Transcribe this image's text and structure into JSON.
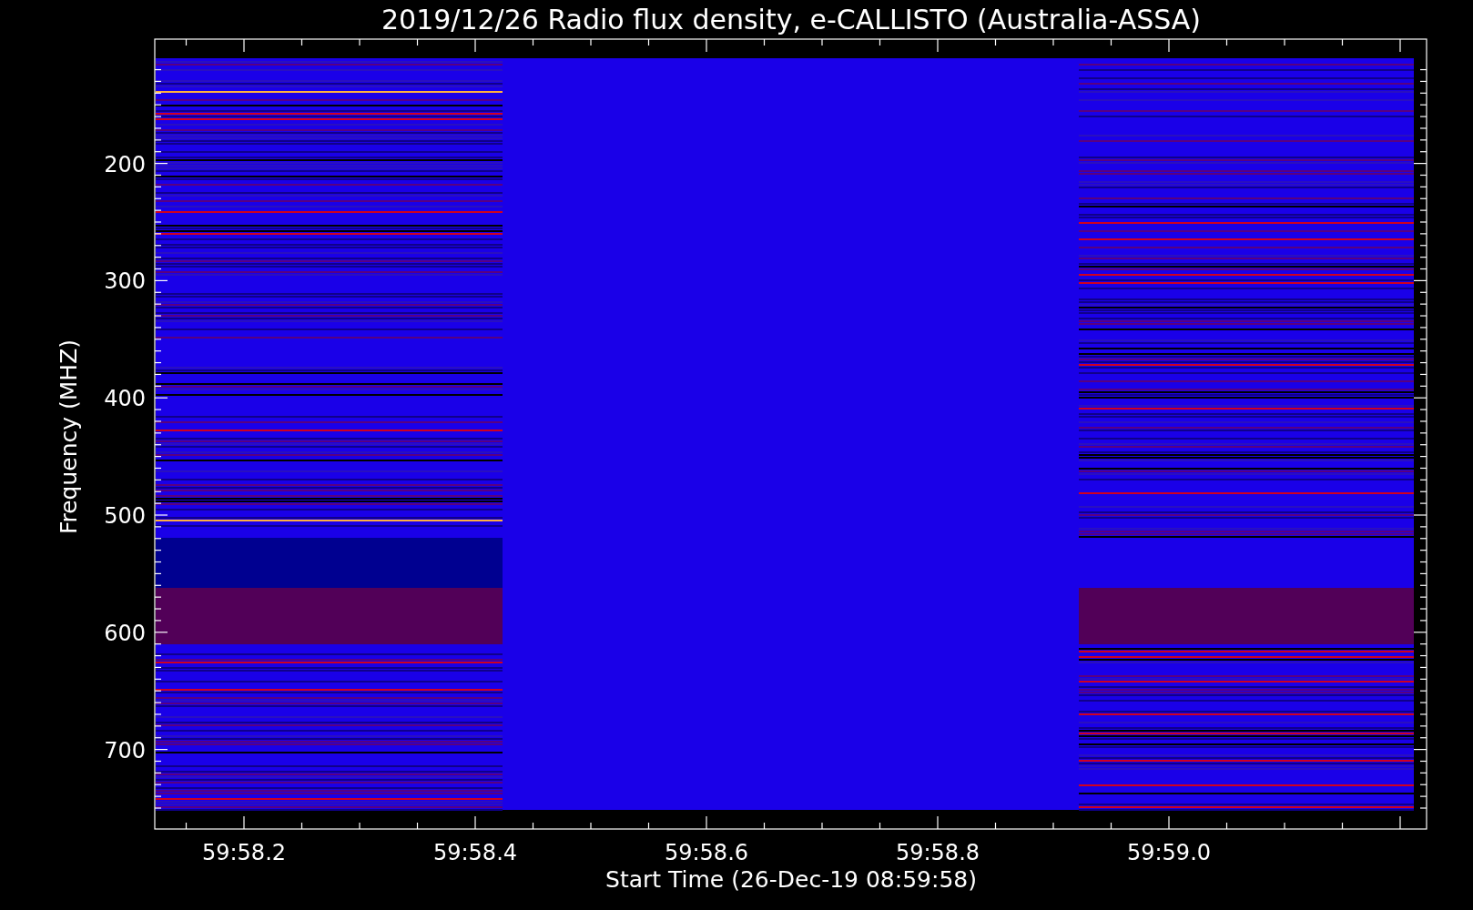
{
  "title": "2019/12/26  Radio flux density, e-CALLISTO (Australia-ASSA)",
  "y_axis": {
    "label": "Frequency (MHZ)",
    "ticks": [
      "200",
      "300",
      "400",
      "500",
      "600",
      "700"
    ]
  },
  "x_axis": {
    "label": "Start Time (26-Dec-19 08:59:58)",
    "ticks": [
      "59:58.2",
      "59:58.4",
      "59:58.6",
      "59:58.8",
      "59:59.0"
    ]
  }
}
